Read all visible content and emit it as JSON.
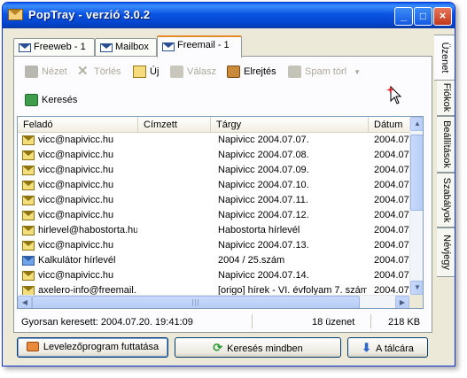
{
  "window": {
    "title": "PopTray - verzió 3.0.2",
    "controls": {
      "minimize": "_",
      "maximize": "□",
      "close": "×"
    }
  },
  "tabs": [
    {
      "label": "Freeweb - 1",
      "active": false
    },
    {
      "label": "Mailbox",
      "active": false
    },
    {
      "label": "Freemail - 1",
      "active": true
    }
  ],
  "side_tabs": [
    {
      "label": "Üzenet",
      "active": true
    },
    {
      "label": "Fiókok",
      "active": false
    },
    {
      "label": "Beállítások",
      "active": false
    },
    {
      "label": "Szabályok",
      "active": false
    },
    {
      "label": "Névjegy",
      "active": false
    }
  ],
  "toolbar": {
    "view": {
      "label": "Nézet",
      "icon": "eye-icon",
      "enabled": false
    },
    "delete": {
      "label": "Törlés",
      "icon": "delete-x-icon",
      "enabled": false
    },
    "new": {
      "label": "Új",
      "icon": "new-mail-icon",
      "enabled": true
    },
    "reply": {
      "label": "Válasz",
      "icon": "reply-icon",
      "enabled": false
    },
    "hide": {
      "label": "Elrejtés",
      "icon": "hide-icon",
      "enabled": true
    },
    "spam": {
      "label": "Spam törl",
      "icon": "spam-icon",
      "enabled": false
    },
    "search": {
      "label": "Keresés",
      "icon": "refresh-search-icon",
      "enabled": true
    }
  },
  "list": {
    "columns": [
      "Feladó",
      "Címzett",
      "Tárgy",
      "Dátum"
    ],
    "rows": [
      {
        "from": "vicc@napivicc.hu",
        "to": "",
        "subject": "Napivicc 2004.07.07.",
        "date": "2004.07"
      },
      {
        "from": "vicc@napivicc.hu",
        "to": "",
        "subject": "Napivicc 2004.07.08.",
        "date": "2004.07"
      },
      {
        "from": "vicc@napivicc.hu",
        "to": "",
        "subject": "Napivicc 2004.07.09.",
        "date": "2004.07"
      },
      {
        "from": "vicc@napivicc.hu",
        "to": "",
        "subject": "Napivicc 2004.07.10.",
        "date": "2004.07"
      },
      {
        "from": "vicc@napivicc.hu",
        "to": "",
        "subject": "Napivicc 2004.07.11.",
        "date": "2004.07"
      },
      {
        "from": "vicc@napivicc.hu",
        "to": "",
        "subject": "Napivicc 2004.07.12.",
        "date": "2004.07"
      },
      {
        "from": "hirlevel@habostorta.hu",
        "to": "",
        "subject": "Habostorta hírlevél",
        "date": "2004.07"
      },
      {
        "from": "vicc@napivicc.hu",
        "to": "",
        "subject": "Napivicc 2004.07.13.",
        "date": "2004.07"
      },
      {
        "from": "Kalkulátor hírlevél",
        "to": "",
        "subject": "2004 / 25.szám",
        "date": "2004.07"
      },
      {
        "from": "vicc@napivicc.hu",
        "to": "",
        "subject": "Napivicc 2004.07.14.",
        "date": "2004.07"
      },
      {
        "from": "axelero-info@freemail....",
        "to": "",
        "subject": "[origo] hírek - VI. évfolyam 7. szám",
        "date": "2004.07"
      }
    ]
  },
  "status": {
    "last_check": "Gyorsan keresett: 2004.07.20. 19:41:09",
    "count": "18 üzenet",
    "size": "218 KB"
  },
  "buttons": {
    "run_client": "Levelezőprogram futtatása",
    "check_all": "Keresés mindben",
    "to_tray": "A tálcára"
  },
  "colors": {
    "title_bar": "#0a54e3",
    "active_tab_accent": "#e68b2c",
    "window_bg": "#ece9d8"
  }
}
